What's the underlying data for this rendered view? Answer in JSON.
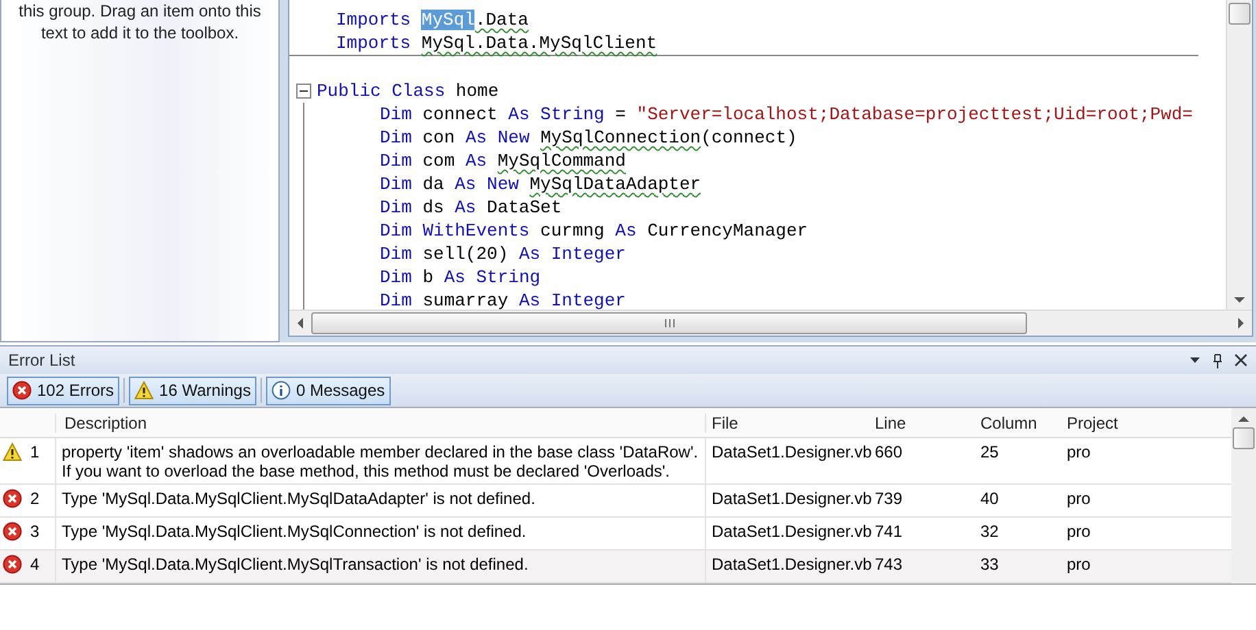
{
  "toolbox": {
    "hint_lines": [
      "this group. Drag an item onto this",
      "text to add it to the toolbox."
    ]
  },
  "editor": {
    "lines": [
      {
        "kind": "import",
        "tokens": [
          {
            "text": "Imports ",
            "kind": "keyword"
          },
          {
            "text": "MySql",
            "kind": "selected"
          },
          {
            "text": ".Data",
            "kind": "error"
          }
        ]
      },
      {
        "kind": "import",
        "tokens": [
          {
            "text": "Imports ",
            "kind": "keyword"
          },
          {
            "text": "MySql.Data.MySqlClient",
            "kind": "error"
          }
        ]
      },
      {
        "kind": "blank"
      },
      {
        "kind": "class",
        "expanded": true,
        "tokens": [
          {
            "text": "Public ",
            "kind": "keyword"
          },
          {
            "text": "Class ",
            "kind": "keyword"
          },
          {
            "text": "home",
            "kind": "plain"
          }
        ]
      },
      {
        "kind": "member",
        "tokens": [
          {
            "text": "Dim ",
            "kind": "keyword"
          },
          {
            "text": "connect ",
            "kind": "plain"
          },
          {
            "text": "As ",
            "kind": "keyword"
          },
          {
            "text": "String ",
            "kind": "keyword"
          },
          {
            "text": "= ",
            "kind": "plain"
          },
          {
            "text": "\"Server=localhost;Database=projecttest;Uid=root;Pwd=",
            "kind": "string"
          }
        ]
      },
      {
        "kind": "member",
        "tokens": [
          {
            "text": "Dim ",
            "kind": "keyword"
          },
          {
            "text": "con ",
            "kind": "plain"
          },
          {
            "text": "As ",
            "kind": "keyword"
          },
          {
            "text": "New ",
            "kind": "keyword"
          },
          {
            "text": "MySqlConnection",
            "kind": "error"
          },
          {
            "text": "(connect)",
            "kind": "plain"
          }
        ]
      },
      {
        "kind": "member",
        "tokens": [
          {
            "text": "Dim ",
            "kind": "keyword"
          },
          {
            "text": "com ",
            "kind": "plain"
          },
          {
            "text": "As ",
            "kind": "keyword"
          },
          {
            "text": "MySqlCommand",
            "kind": "error"
          }
        ]
      },
      {
        "kind": "member",
        "tokens": [
          {
            "text": "Dim ",
            "kind": "keyword"
          },
          {
            "text": "da ",
            "kind": "plain"
          },
          {
            "text": "As ",
            "kind": "keyword"
          },
          {
            "text": "New ",
            "kind": "keyword"
          },
          {
            "text": "MySqlDataAdapter",
            "kind": "error"
          }
        ]
      },
      {
        "kind": "member",
        "tokens": [
          {
            "text": "Dim ",
            "kind": "keyword"
          },
          {
            "text": "ds ",
            "kind": "plain"
          },
          {
            "text": "As ",
            "kind": "keyword"
          },
          {
            "text": "DataSet",
            "kind": "plain"
          }
        ]
      },
      {
        "kind": "member",
        "tokens": [
          {
            "text": "Dim ",
            "kind": "keyword"
          },
          {
            "text": "WithEvents ",
            "kind": "keyword"
          },
          {
            "text": "curmng ",
            "kind": "plain"
          },
          {
            "text": "As ",
            "kind": "keyword"
          },
          {
            "text": "CurrencyManager",
            "kind": "plain"
          }
        ]
      },
      {
        "kind": "member",
        "tokens": [
          {
            "text": "Dim ",
            "kind": "keyword"
          },
          {
            "text": "sell(20) ",
            "kind": "plain"
          },
          {
            "text": "As ",
            "kind": "keyword"
          },
          {
            "text": "Integer",
            "kind": "keyword"
          }
        ]
      },
      {
        "kind": "member",
        "tokens": [
          {
            "text": "Dim ",
            "kind": "keyword"
          },
          {
            "text": "b ",
            "kind": "plain"
          },
          {
            "text": "As ",
            "kind": "keyword"
          },
          {
            "text": "String",
            "kind": "keyword"
          }
        ]
      },
      {
        "kind": "member",
        "tokens": [
          {
            "text": "Dim ",
            "kind": "keyword"
          },
          {
            "text": "sumarray ",
            "kind": "plain"
          },
          {
            "text": "As ",
            "kind": "keyword"
          },
          {
            "text": "Integer",
            "kind": "keyword"
          }
        ]
      }
    ]
  },
  "error_list": {
    "title": "Error List",
    "filters": [
      {
        "kind": "error",
        "label": "102 Errors",
        "selected": true
      },
      {
        "kind": "warning",
        "label": "16 Warnings",
        "selected": true
      },
      {
        "kind": "message",
        "label": "0 Messages",
        "selected": true
      }
    ],
    "columns": [
      "Description",
      "File",
      "Line",
      "Column",
      "Project"
    ],
    "rows": [
      {
        "kind": "warning",
        "number": "1",
        "description": [
          "property 'item' shadows an overloadable member declared in the base class 'DataRow'.",
          "If you want to overload the base method, this method must be declared 'Overloads'."
        ],
        "file": "DataSet1.Designer.vb",
        "line": "660",
        "column": "25",
        "project": "pro"
      },
      {
        "kind": "error",
        "number": "2",
        "description": [
          "Type 'MySql.Data.MySqlClient.MySqlDataAdapter' is not defined."
        ],
        "file": "DataSet1.Designer.vb",
        "line": "739",
        "column": "40",
        "project": "pro"
      },
      {
        "kind": "error",
        "number": "3",
        "description": [
          "Type 'MySql.Data.MySqlClient.MySqlConnection' is not defined."
        ],
        "file": "DataSet1.Designer.vb",
        "line": "741",
        "column": "32",
        "project": "pro"
      },
      {
        "kind": "error",
        "number": "4",
        "description": [
          "Type 'MySql.Data.MySqlClient.MySqlTransaction' is not defined."
        ],
        "file": "DataSet1.Designer.vb",
        "line": "743",
        "column": "33",
        "project": "pro"
      }
    ]
  }
}
